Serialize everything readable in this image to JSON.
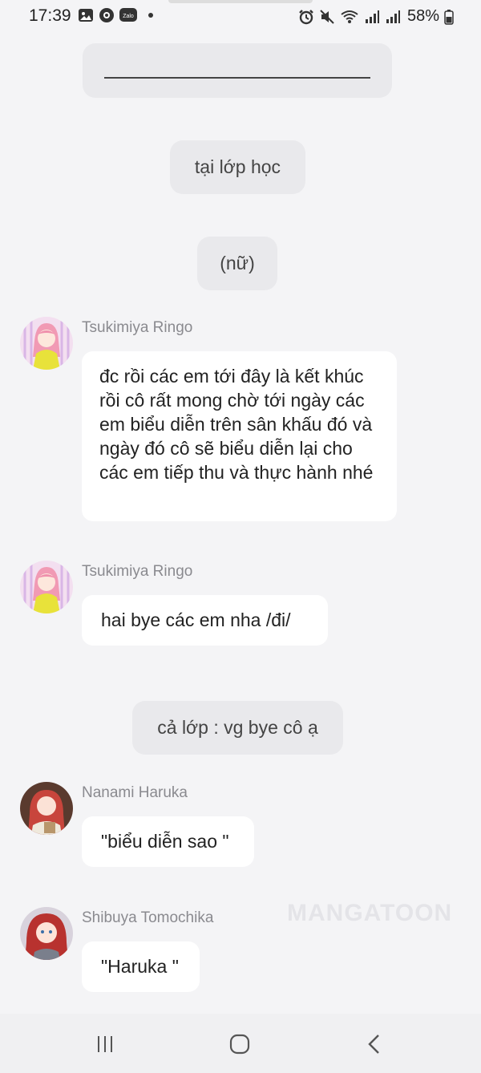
{
  "status_bar": {
    "time": "17:39",
    "battery": "58%",
    "left_icons": [
      "gallery-icon",
      "messenger-icon",
      "zalo-icon"
    ],
    "zalo_label": "Zalo",
    "right_icons": [
      "alarm-icon",
      "mute-icon",
      "wifi-icon",
      "signal-icon",
      "signal-icon",
      "battery-icon"
    ]
  },
  "chat": {
    "narration_1": "tại lớp học",
    "narration_2": "(nữ)",
    "narration_3": "cả lớp : vg bye cô ạ",
    "messages": [
      {
        "speaker": "Tsukimiya Ringo",
        "text": "đc rồi các em tới đây là kết khúc rồi cô rất mong chờ tới ngày các em biểu diễn trên sân khấu đó và ngày đó cô sẽ biểu diễn lại cho các em tiếp thu và thực hành nhé"
      },
      {
        "speaker": "Tsukimiya Ringo",
        "text": "hai bye các em nha /đi/"
      },
      {
        "speaker": "Nanami Haruka",
        "text": "\"biểu diễn sao \""
      },
      {
        "speaker": "Shibuya Tomochika",
        "text": "\"Haruka \""
      }
    ]
  },
  "watermark": "MANGATOON",
  "colors": {
    "background": "#f4f4f6",
    "narration_bg": "#e9e9ec",
    "bubble_bg": "#ffffff",
    "speaker_text": "#8a8a8f"
  },
  "nav_bar": {
    "icons": [
      "recent-apps-icon",
      "home-icon",
      "back-icon"
    ]
  }
}
